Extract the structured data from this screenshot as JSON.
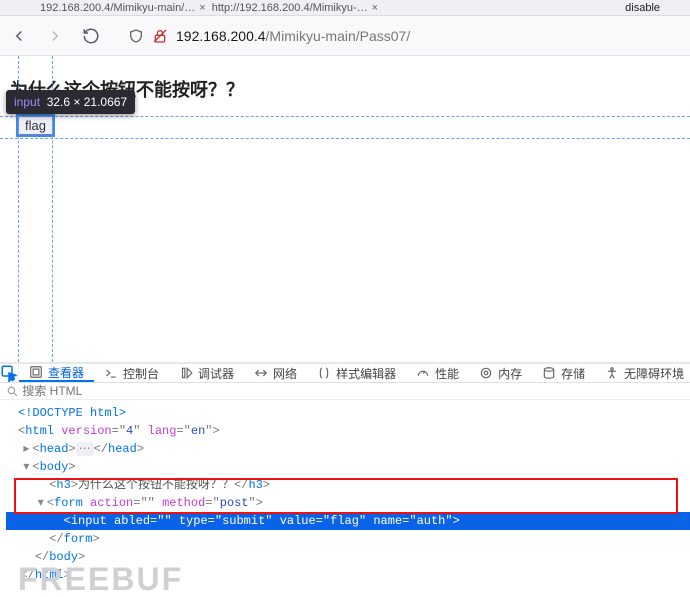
{
  "tabstrip": {
    "tab1": "192.168.200.4/Mimikyu-main/…",
    "tab2": "http://192.168.200.4/Mimikyu-…",
    "closed_glyph": "×",
    "right_text": "disable"
  },
  "toolbar": {
    "url_host": "192.168.200.4",
    "url_path": "/Mimikyu-main/Pass07/"
  },
  "page": {
    "heading": "为什么这个按钮不能按呀？？",
    "button_value": "flag"
  },
  "tooltip": {
    "tag": "input",
    "dims": "32.6 × 21.0667"
  },
  "devtools": {
    "tabs": {
      "inspector": "查看器",
      "console": "控制台",
      "debugger": "调试器",
      "network": "网络",
      "styleeditor": "样式编辑器",
      "performance": "性能",
      "memory": "内存",
      "storage": "存储",
      "accessibility": "无障碍环境"
    },
    "search_placeholder": "搜索 HTML",
    "dom": {
      "doctype": "<!DOCTYPE html>",
      "html_open": "html",
      "html_attr_version": "version",
      "html_val_version": "4",
      "html_attr_lang": "lang",
      "html_val_lang": "en",
      "head": "head",
      "body": "body",
      "h3_open": "h3",
      "h3_text": "为什么这个按钮不能按呀？？",
      "form": "form",
      "form_attr_action": "action",
      "form_val_action": "",
      "form_attr_method": "method",
      "form_val_method": "post",
      "input": "input",
      "input_attr_abled": "abled",
      "input_val_abled": "",
      "input_attr_type": "type",
      "input_val_type": "submit",
      "input_attr_value": "value",
      "input_val_value": "flag",
      "input_attr_name": "name",
      "input_val_name": "auth"
    }
  },
  "watermark": "FREEBUF"
}
